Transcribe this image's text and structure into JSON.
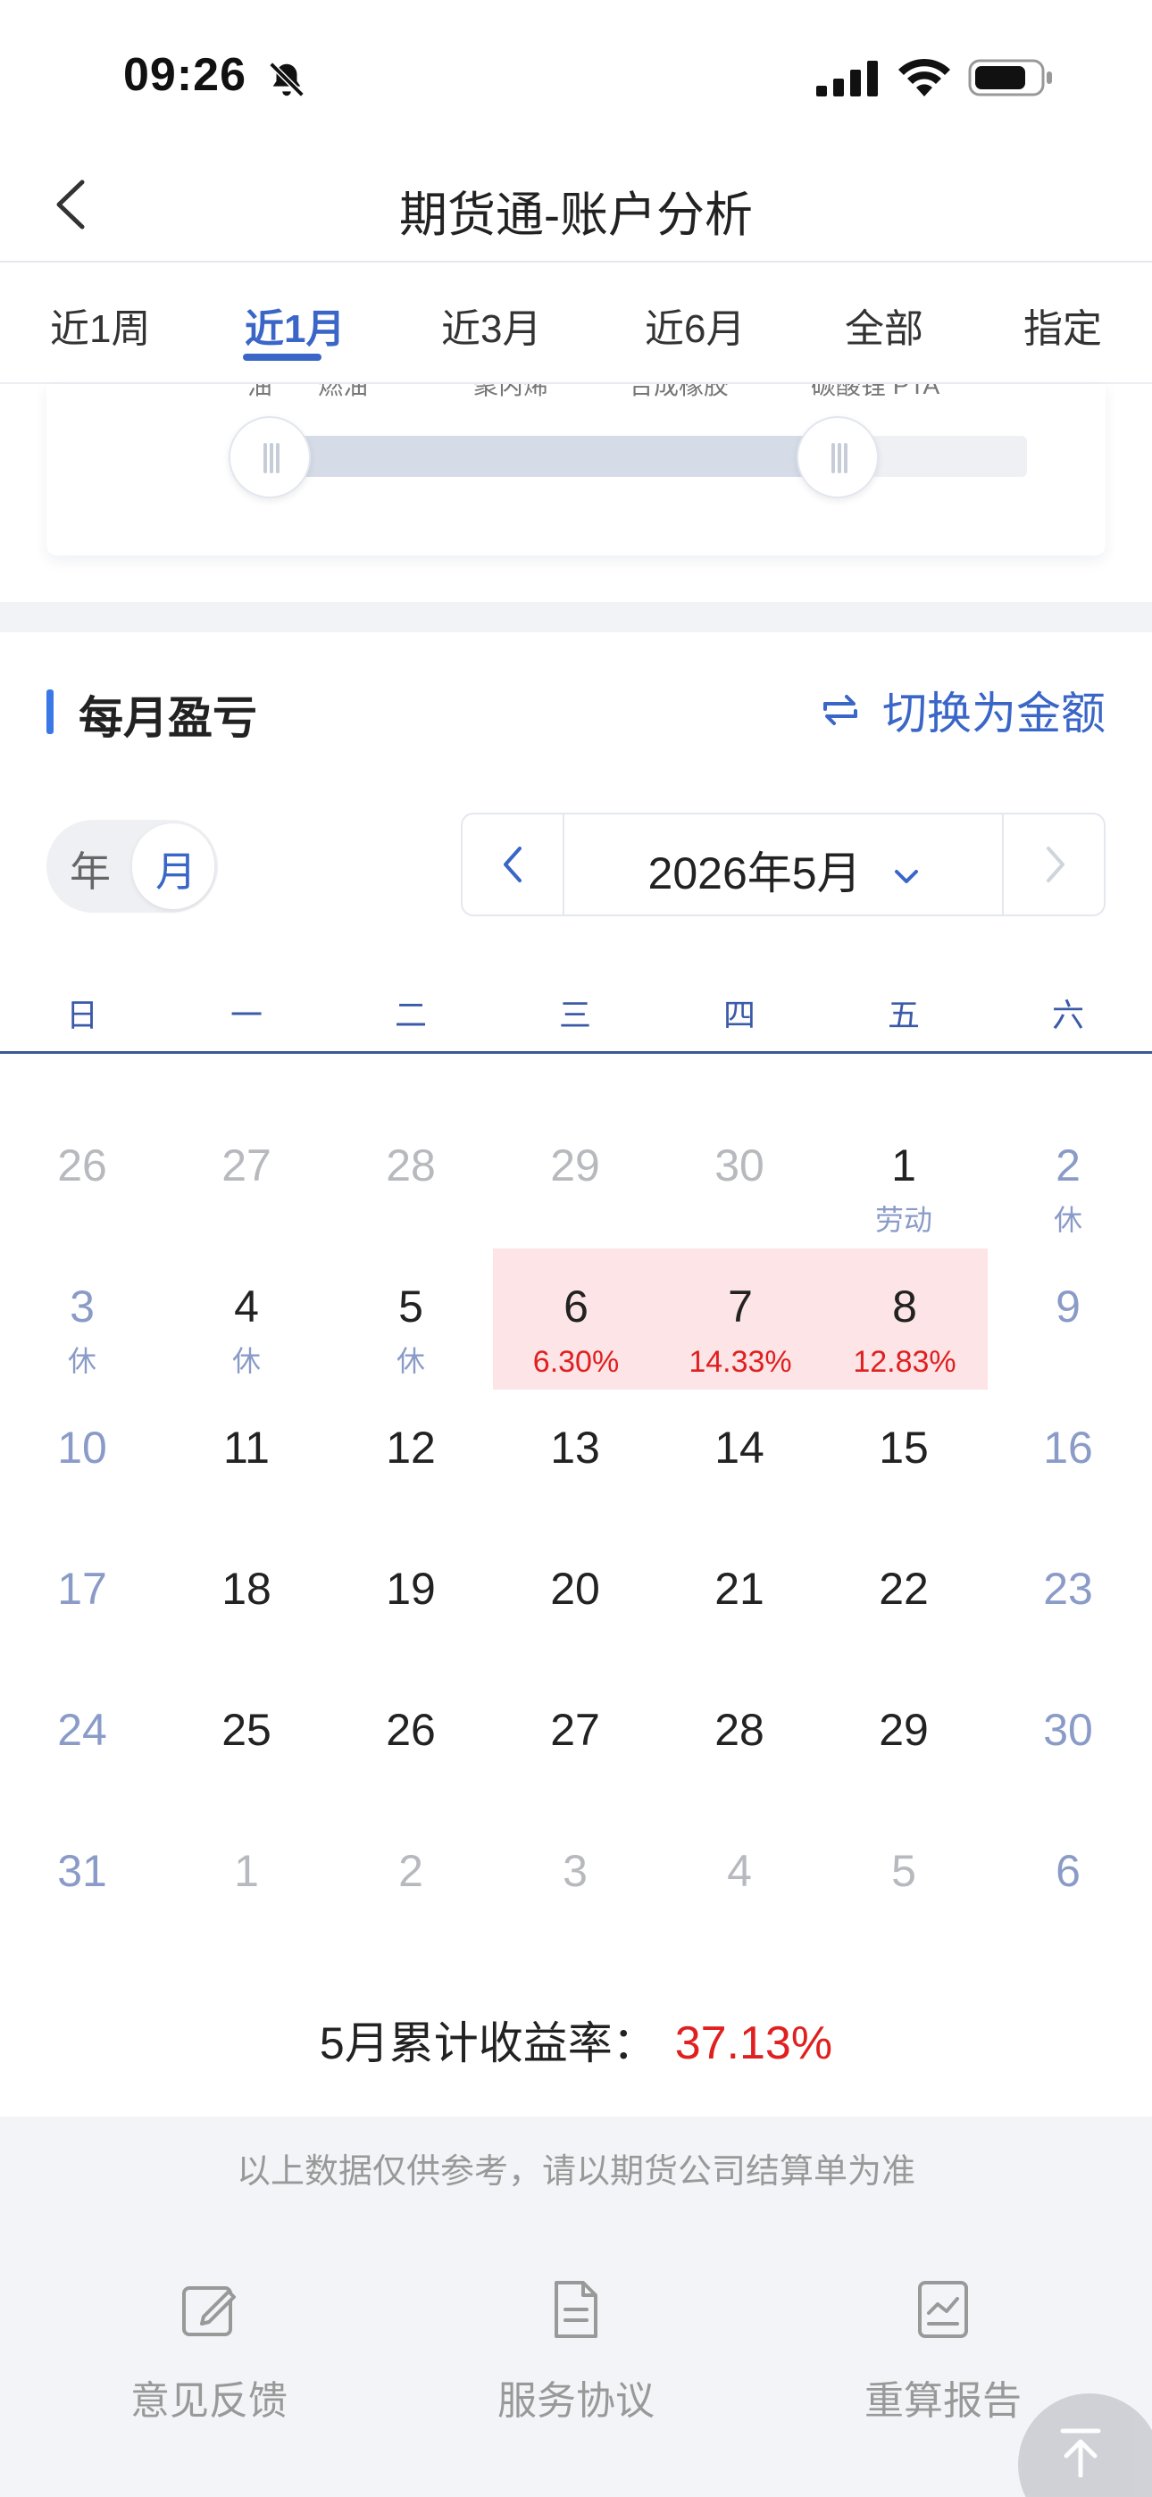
{
  "status_bar": {
    "time": "09:26"
  },
  "nav": {
    "title": "期货通-账户分析"
  },
  "tabs": [
    {
      "label": "近1周",
      "active": false
    },
    {
      "label": "近1月",
      "active": true
    },
    {
      "label": "近3月",
      "active": false
    },
    {
      "label": "近6月",
      "active": false
    },
    {
      "label": "全部",
      "active": false
    },
    {
      "label": "指定",
      "active": false
    }
  ],
  "slider": {
    "labels": [
      "''油",
      "燃油",
      "聚丙烯",
      "合成橡胶",
      "碳酸锂 PTA"
    ],
    "range_start": 0.0,
    "range_end": 0.75
  },
  "section": {
    "title": "每月盈亏",
    "switch_label": "切换为金额"
  },
  "year_month_toggle": {
    "year": "年",
    "month": "月",
    "selected": "月"
  },
  "month_picker": {
    "label": "2026年5月"
  },
  "weekdays": [
    "日",
    "一",
    "二",
    "三",
    "四",
    "五",
    "六"
  ],
  "calendar": [
    [
      {
        "d": "26",
        "t": "gray"
      },
      {
        "d": "27",
        "t": "gray"
      },
      {
        "d": "28",
        "t": "gray"
      },
      {
        "d": "29",
        "t": "gray"
      },
      {
        "d": "30",
        "t": "gray"
      },
      {
        "d": "1",
        "t": "normal",
        "sub": "劳动"
      },
      {
        "d": "2",
        "t": "weekend",
        "sub": "休"
      }
    ],
    [
      {
        "d": "3",
        "t": "weekend",
        "sub": "休"
      },
      {
        "d": "4",
        "t": "normal",
        "sub": "休"
      },
      {
        "d": "5",
        "t": "normal",
        "sub": "休"
      },
      {
        "d": "6",
        "t": "profit",
        "pct": "6.30%"
      },
      {
        "d": "7",
        "t": "profit",
        "pct": "14.33%"
      },
      {
        "d": "8",
        "t": "profit",
        "pct": "12.83%"
      },
      {
        "d": "9",
        "t": "weekend"
      }
    ],
    [
      {
        "d": "10",
        "t": "weekend"
      },
      {
        "d": "11",
        "t": "normal"
      },
      {
        "d": "12",
        "t": "normal"
      },
      {
        "d": "13",
        "t": "normal"
      },
      {
        "d": "14",
        "t": "normal"
      },
      {
        "d": "15",
        "t": "normal"
      },
      {
        "d": "16",
        "t": "weekend"
      }
    ],
    [
      {
        "d": "17",
        "t": "weekend"
      },
      {
        "d": "18",
        "t": "normal"
      },
      {
        "d": "19",
        "t": "normal"
      },
      {
        "d": "20",
        "t": "normal"
      },
      {
        "d": "21",
        "t": "normal"
      },
      {
        "d": "22",
        "t": "normal"
      },
      {
        "d": "23",
        "t": "weekend"
      }
    ],
    [
      {
        "d": "24",
        "t": "weekend"
      },
      {
        "d": "25",
        "t": "normal"
      },
      {
        "d": "26",
        "t": "normal"
      },
      {
        "d": "27",
        "t": "normal"
      },
      {
        "d": "28",
        "t": "normal"
      },
      {
        "d": "29",
        "t": "normal"
      },
      {
        "d": "30",
        "t": "weekend"
      }
    ],
    [
      {
        "d": "31",
        "t": "weekend"
      },
      {
        "d": "1",
        "t": "gray"
      },
      {
        "d": "2",
        "t": "gray"
      },
      {
        "d": "3",
        "t": "gray"
      },
      {
        "d": "4",
        "t": "gray"
      },
      {
        "d": "5",
        "t": "gray"
      },
      {
        "d": "6",
        "t": "weekend"
      }
    ]
  ],
  "cumulative": {
    "label": "5月累计收益率：",
    "value": "37.13%"
  },
  "footer": {
    "disclaimer": "以上数据仅供参考，请以期货公司结算单为准",
    "items": [
      {
        "label": "意见反馈",
        "icon": "edit-icon"
      },
      {
        "label": "服务协议",
        "icon": "document-icon"
      },
      {
        "label": "重算报告",
        "icon": "report-icon"
      }
    ]
  },
  "colors": {
    "accent": "#3a66c8",
    "profit_bg": "#fde4e6",
    "profit_text": "#e02020",
    "weekend": "#8a9bc8"
  }
}
